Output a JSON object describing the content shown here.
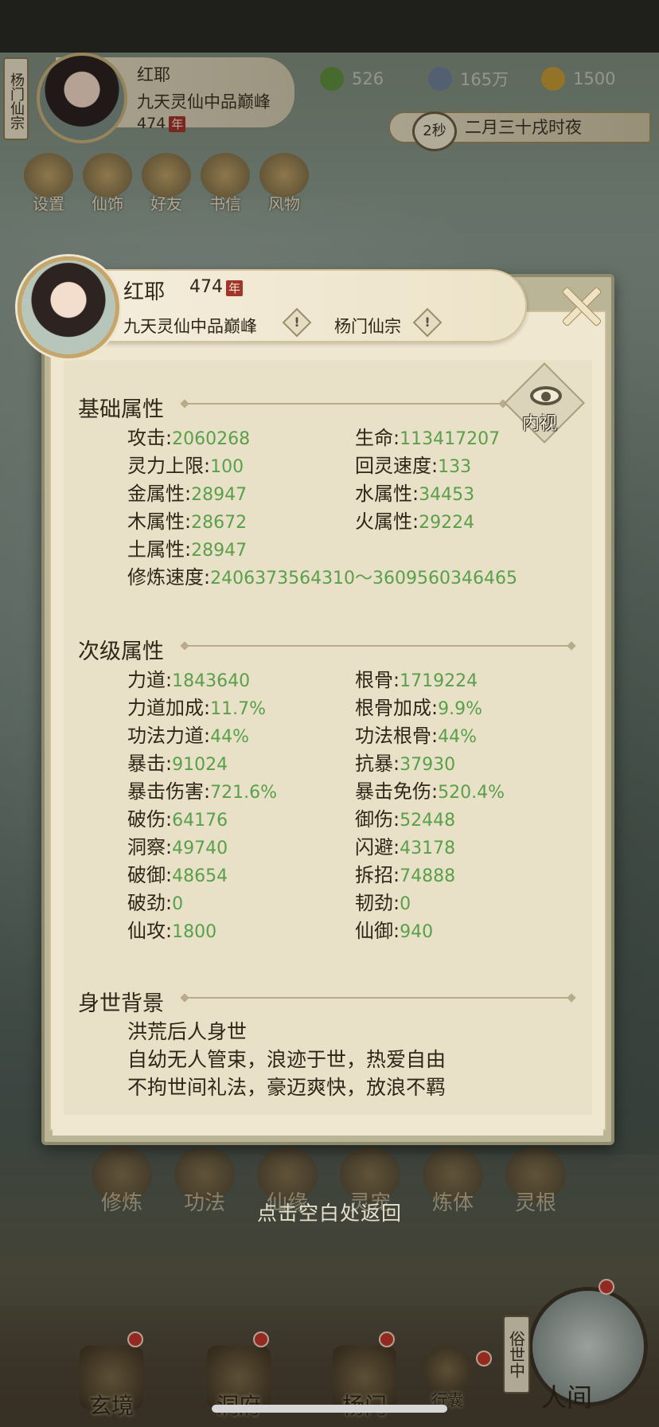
{
  "hud": {
    "sect_tag": "杨门仙宗",
    "name": "红耶",
    "rank": "九天灵仙中品巅峰",
    "age": "474",
    "age_unit": "年",
    "resources": [
      {
        "icon": "jade-icon",
        "value": "526",
        "color": "#6a9a45"
      },
      {
        "icon": "coin-icon",
        "value": "165万",
        "color": "#7b8ca5"
      },
      {
        "icon": "strength-icon",
        "value": "1500",
        "color": "#d0a030"
      }
    ],
    "timer": "2秒",
    "date": "二月三十戌时夜",
    "nav": [
      {
        "label": "设置",
        "icon": "settings-icon"
      },
      {
        "label": "仙饰",
        "icon": "costume-icon"
      },
      {
        "label": "好友",
        "icon": "friends-icon"
      },
      {
        "label": "书信",
        "icon": "letter-icon"
      },
      {
        "label": "风物",
        "icon": "scenery-icon"
      }
    ]
  },
  "panel": {
    "name": "红耶",
    "age": "474",
    "age_unit": "年",
    "rank": "九天灵仙中品巅峰",
    "sect": "杨门仙宗",
    "info_mark": "!",
    "inner_view_label": "内视",
    "basic": {
      "title": "基础属性",
      "stats": [
        {
          "label": "攻击",
          "value": "2060268"
        },
        {
          "label": "生命",
          "value": "113417207"
        },
        {
          "label": "灵力上限",
          "value": "100"
        },
        {
          "label": "回灵速度",
          "value": "133"
        },
        {
          "label": "金属性",
          "value": "28947"
        },
        {
          "label": "水属性",
          "value": "34453"
        },
        {
          "label": "木属性",
          "value": "28672"
        },
        {
          "label": "火属性",
          "value": "29224"
        },
        {
          "label": "土属性",
          "value": "28947"
        },
        {
          "label": "修炼速度",
          "value": "2406373564310～3609560346465"
        }
      ]
    },
    "secondary": {
      "title": "次级属性",
      "stats": [
        {
          "label": "力道",
          "value": "1843640"
        },
        {
          "label": "根骨",
          "value": "1719224"
        },
        {
          "label": "力道加成",
          "value": "11.7%"
        },
        {
          "label": "根骨加成",
          "value": "9.9%"
        },
        {
          "label": "功法力道",
          "value": "44%"
        },
        {
          "label": "功法根骨",
          "value": "44%"
        },
        {
          "label": "暴击",
          "value": "91024"
        },
        {
          "label": "抗暴",
          "value": "37930"
        },
        {
          "label": "暴击伤害",
          "value": "721.6%"
        },
        {
          "label": "暴击免伤",
          "value": "520.4%"
        },
        {
          "label": "破伤",
          "value": "64176"
        },
        {
          "label": "御伤",
          "value": "52448"
        },
        {
          "label": "洞察",
          "value": "49740"
        },
        {
          "label": "闪避",
          "value": "43178"
        },
        {
          "label": "破御",
          "value": "48654"
        },
        {
          "label": "拆招",
          "value": "74888"
        },
        {
          "label": "破劲",
          "value": "0"
        },
        {
          "label": "韧劲",
          "value": "0"
        },
        {
          "label": "仙攻",
          "value": "1800"
        },
        {
          "label": "仙御",
          "value": "940"
        }
      ]
    },
    "background": {
      "title": "身世背景",
      "lines": [
        "洪荒后人身世",
        "自幼无人管束，浪迹于世，热爱自由",
        "不拘世间礼法，豪迈爽快，放浪不羁"
      ]
    }
  },
  "cultivation_tabs": [
    "修炼",
    "功法",
    "仙缘",
    "灵宠",
    "炼体",
    "灵根"
  ],
  "back_hint": "点击空白处返回",
  "bottom_tabs": [
    {
      "label": "玄境",
      "icon": "realm-icon"
    },
    {
      "label": "洞府",
      "icon": "cave-icon"
    },
    {
      "label": "杨门",
      "icon": "sect-icon"
    },
    {
      "label": "行囊",
      "icon": "bag-icon"
    }
  ],
  "world": {
    "tag": "俗世中",
    "label": "人间"
  }
}
